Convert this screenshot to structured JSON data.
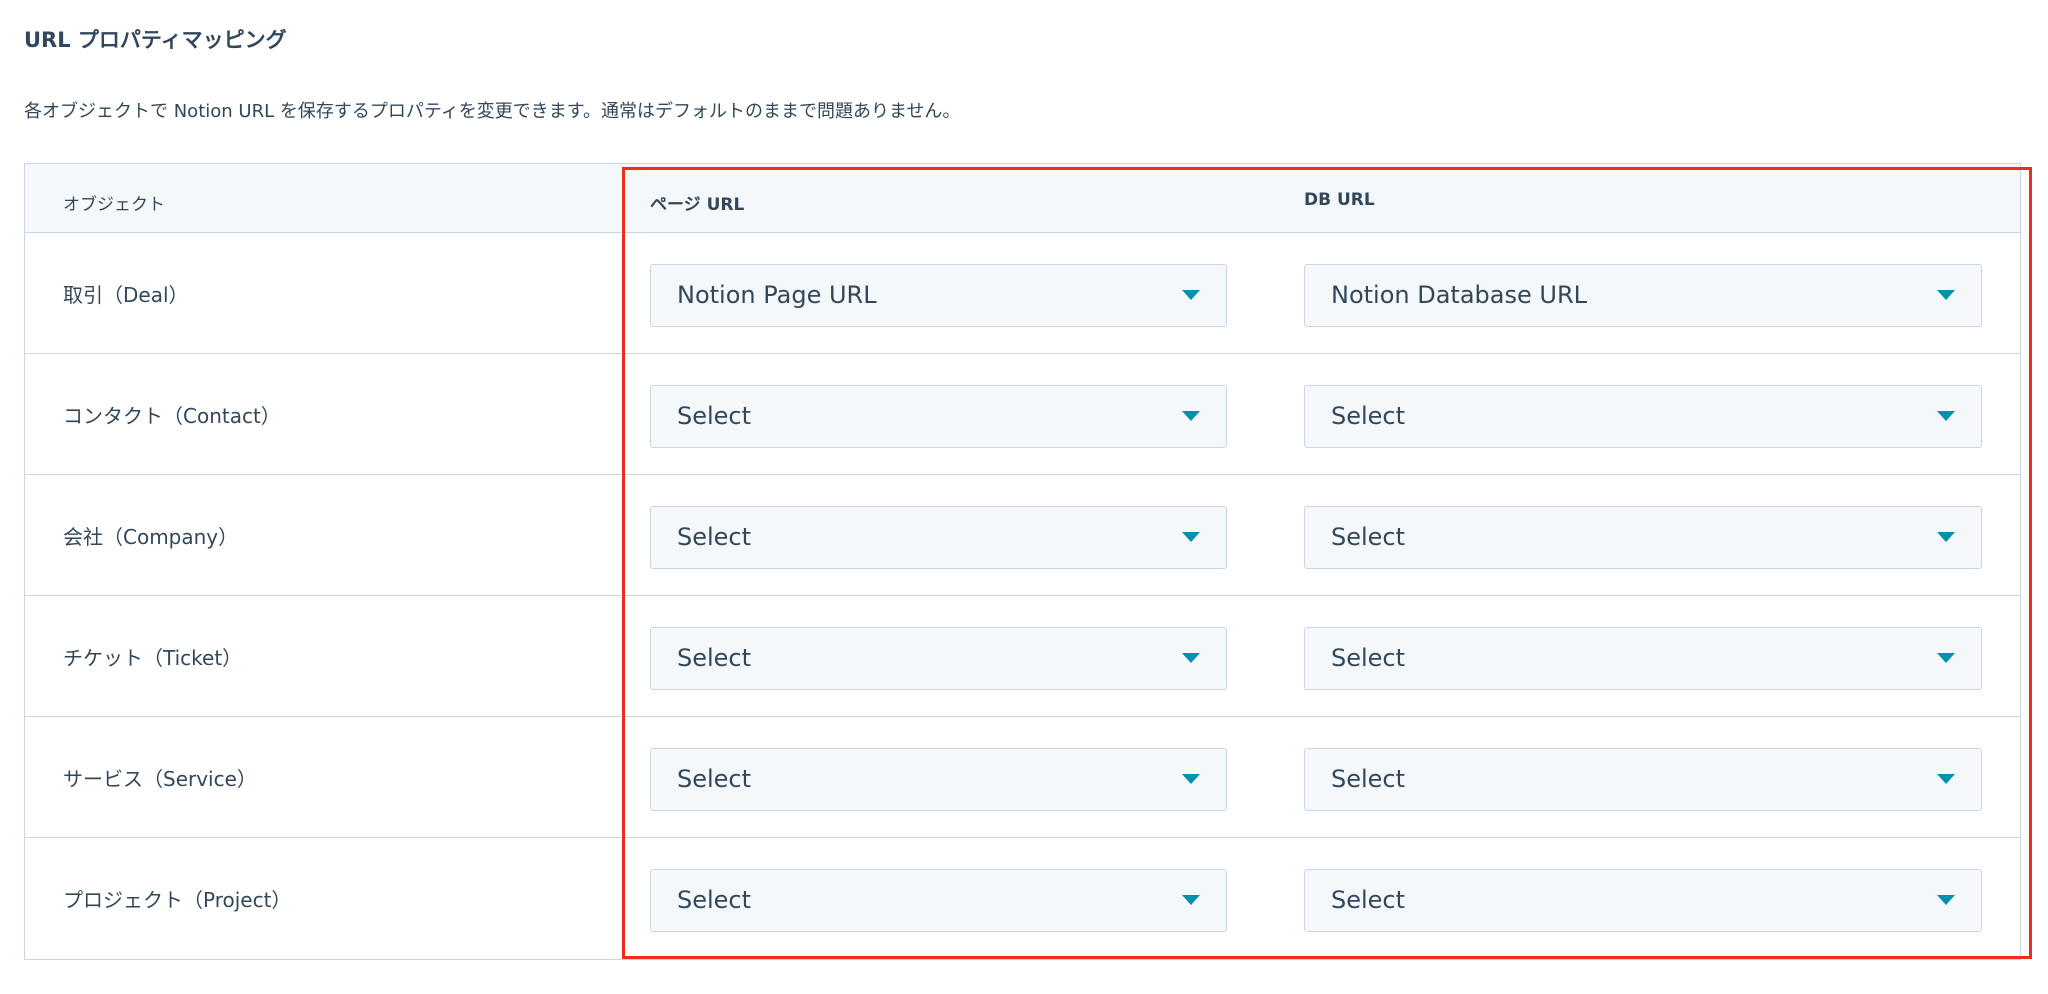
{
  "section": {
    "title": "URL プロパティマッピング",
    "description": "各オブジェクトで Notion URL を保存するプロパティを変更できます。通常はデフォルトのままで問題ありません。"
  },
  "table": {
    "headers": {
      "object": "オブジェクト",
      "page_url": "ページ URL",
      "db_url": "DB URL"
    },
    "rows": [
      {
        "object": "取引（Deal）",
        "page_url": "Notion Page URL",
        "db_url": "Notion Database URL"
      },
      {
        "object": "コンタクト（Contact）",
        "page_url": "Select",
        "db_url": "Select"
      },
      {
        "object": "会社（Company）",
        "page_url": "Select",
        "db_url": "Select"
      },
      {
        "object": "チケット（Ticket）",
        "page_url": "Select",
        "db_url": "Select"
      },
      {
        "object": "サービス（Service）",
        "page_url": "Select",
        "db_url": "Select"
      },
      {
        "object": "プロジェクト（Project）",
        "page_url": "Select",
        "db_url": "Select"
      }
    ]
  },
  "colors": {
    "text": "#33475b",
    "border": "#cbd6e2",
    "select_bg": "#f5f8fa",
    "caret": "#0091ae",
    "highlight": "#f02c1f"
  },
  "icons": {
    "dropdown": "caret-down-icon"
  }
}
